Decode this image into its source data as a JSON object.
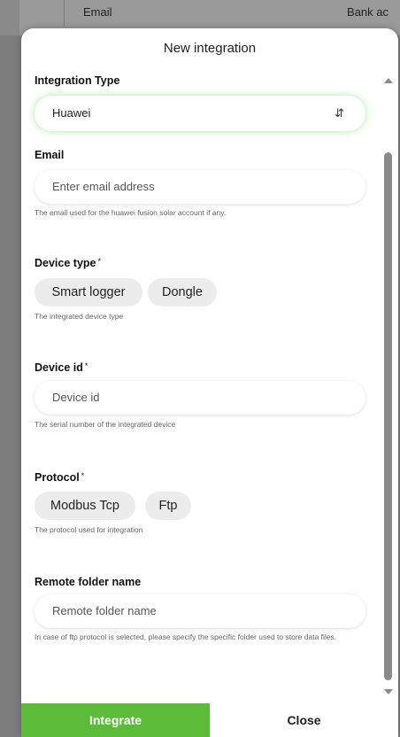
{
  "background": {
    "col_email": "Email",
    "col_bank": "Bank ac"
  },
  "modal": {
    "title": "New integration",
    "integration_type": {
      "label": "Integration Type",
      "value": "Huawei"
    },
    "email": {
      "label": "Email",
      "placeholder": "Enter email address",
      "help": "The email used for the huawei fusion solar account if any."
    },
    "device_type": {
      "label": "Device type",
      "required": "*",
      "options": [
        "Smart logger",
        "Dongle"
      ],
      "help": "The integrated device type"
    },
    "device_id": {
      "label": "Device id",
      "required": "*",
      "placeholder": "Device id",
      "help": "The serial number of the integrated device"
    },
    "protocol": {
      "label": "Protocol",
      "required": "*",
      "options": [
        "Modbus Tcp",
        "Ftp"
      ],
      "help": "The protocol used for integration"
    },
    "remote_folder": {
      "label": "Remote folder name",
      "placeholder": "Remote folder name",
      "help": "In case of ftp protocol is selected, please specify the specific folder used to store data files."
    },
    "buttons": {
      "integrate": "Integrate",
      "close": "Close"
    }
  },
  "colors": {
    "accent": "#5cbc3a",
    "chip_bg": "#ececec",
    "backdrop": "#7d7d7d"
  }
}
